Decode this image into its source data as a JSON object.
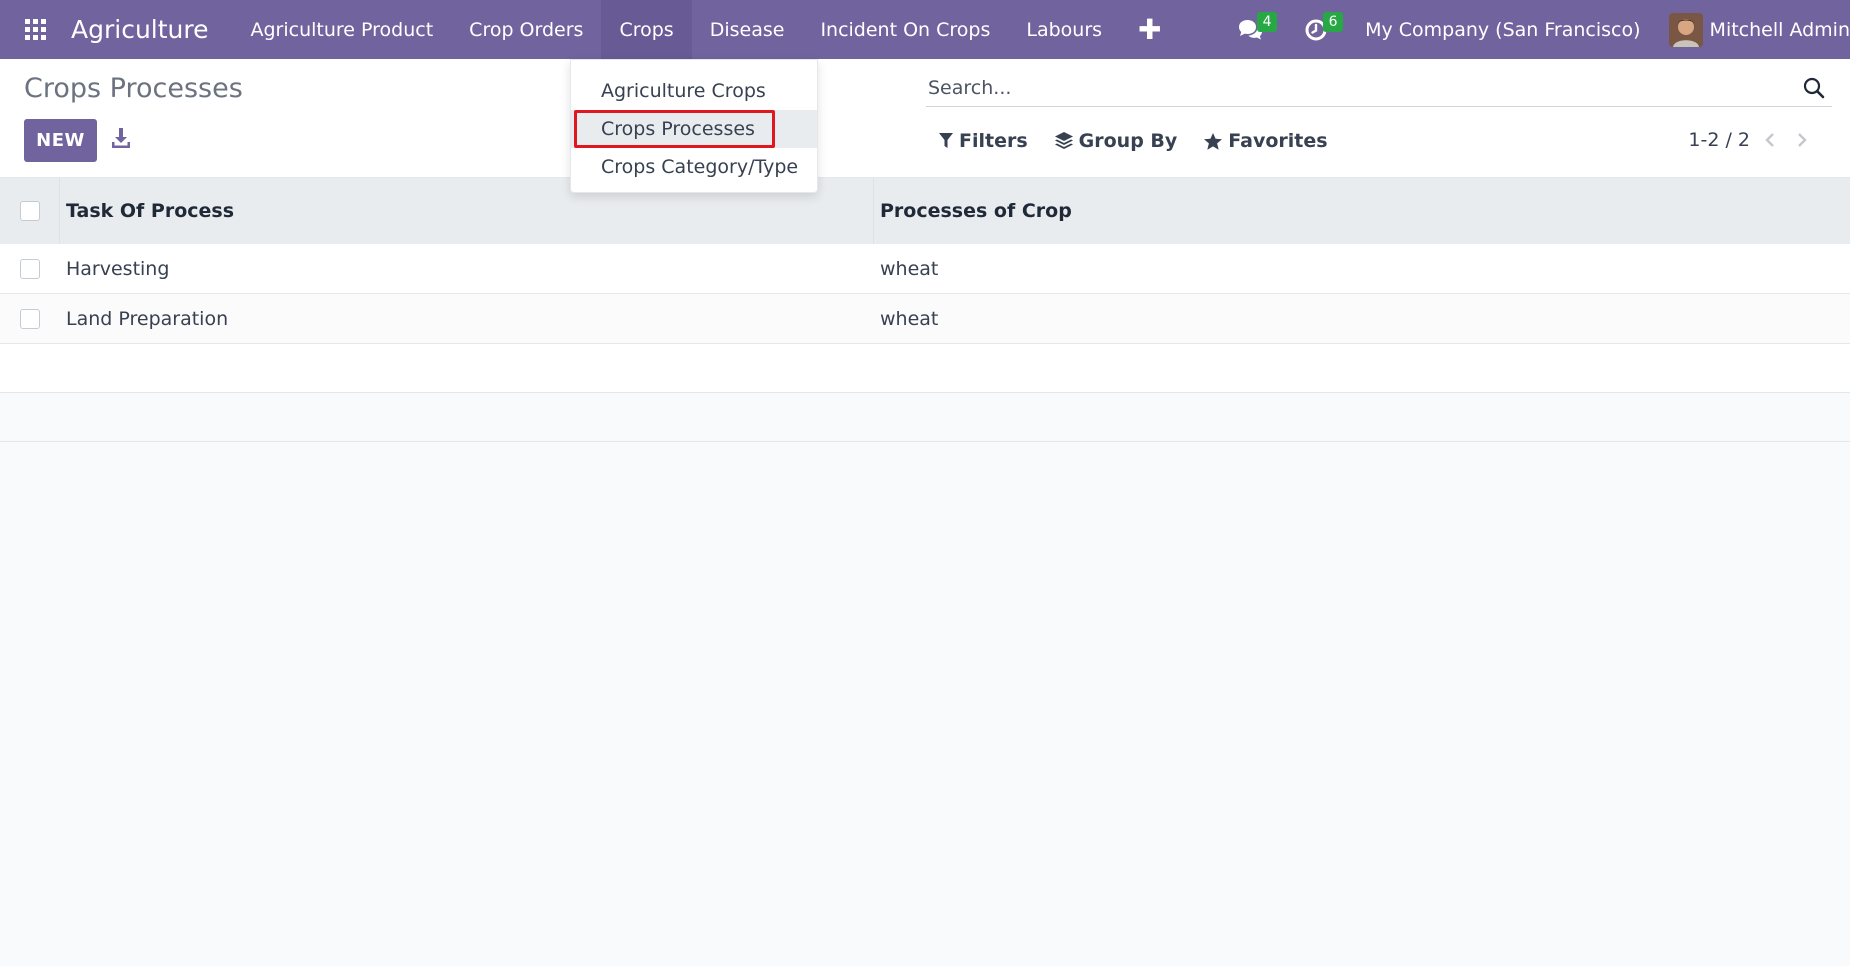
{
  "navbar": {
    "brand": "Agriculture",
    "menu": [
      {
        "label": "Agriculture Product"
      },
      {
        "label": "Crop Orders"
      },
      {
        "label": "Crops"
      },
      {
        "label": "Disease"
      },
      {
        "label": "Incident On Crops"
      },
      {
        "label": "Labours"
      }
    ],
    "plus_label": "✚",
    "messages_badge": "4",
    "activities_badge": "6",
    "company": "My Company (San Francisco)",
    "user": "Mitchell Admin"
  },
  "dropdown": {
    "items": [
      {
        "label": "Agriculture Crops"
      },
      {
        "label": "Crops Processes"
      },
      {
        "label": "Crops Category/Type"
      }
    ]
  },
  "control_panel": {
    "title": "Crops Processes",
    "new_label": "NEW",
    "search_placeholder": "Search...",
    "filters_label": "Filters",
    "group_by_label": "Group By",
    "favorites_label": "Favorites",
    "pager": "1-2 / 2"
  },
  "table": {
    "columns": [
      "Task Of Process",
      "Processes of Crop"
    ],
    "rows": [
      {
        "task": "Harvesting",
        "crop": "wheat"
      },
      {
        "task": "Land Preparation",
        "crop": "wheat"
      }
    ]
  },
  "colors": {
    "brand": "#71639e",
    "highlight_border": "#e0171f",
    "badge": "#28a745"
  }
}
